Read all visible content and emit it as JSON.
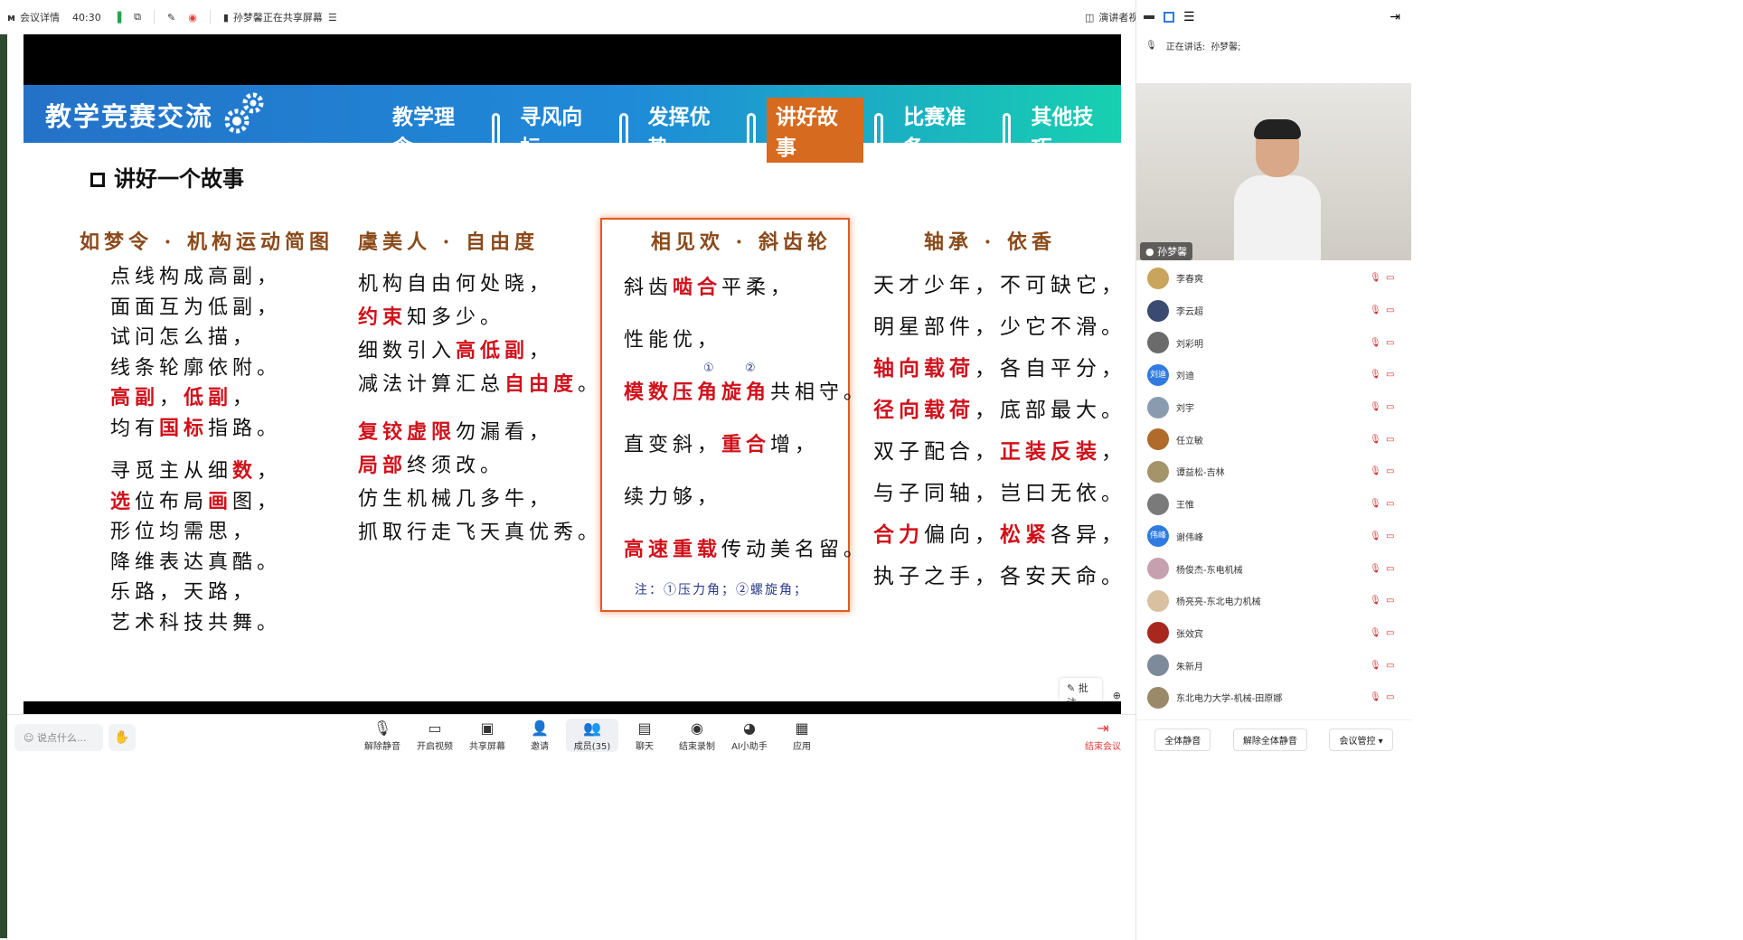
{
  "topbar": {
    "meeting_details": "会议详情",
    "duration": "40:30",
    "sharing_notice": "孙梦馨正在共享屏幕",
    "presenter_view": "演讲者视"
  },
  "slide": {
    "title": "教学竞赛交流",
    "nav": [
      "教学理念",
      "寻风向标",
      "发挥优势",
      "讲好故事",
      "比赛准备",
      "其他技巧"
    ],
    "active_nav": "讲好故事",
    "heading": "讲好一个故事",
    "poem1": {
      "title": "如梦令 · 机构运动简图",
      "lines": [
        [
          {
            "t": "点线构成高副，"
          }
        ],
        [
          {
            "t": "面面互为低副，"
          }
        ],
        [
          {
            "t": "试问怎么描，"
          }
        ],
        [
          {
            "t": "线条轮廓依附。"
          }
        ],
        [
          {
            "t": "高副",
            "r": true
          },
          {
            "t": "，"
          },
          {
            "t": "低副",
            "r": true
          },
          {
            "t": "，"
          }
        ],
        [
          {
            "t": "均有"
          },
          {
            "t": "国标",
            "r": true
          },
          {
            "t": "指路。"
          }
        ]
      ],
      "lines2": [
        [
          {
            "t": "寻"
          },
          {
            "t": "觅",
            "r": false
          },
          {
            "t": "主从细"
          },
          {
            "t": "数",
            "r": true
          },
          {
            "t": "，"
          }
        ],
        [
          {
            "t": "选",
            "r": true
          },
          {
            "t": "位布局"
          },
          {
            "t": "画",
            "r": true
          },
          {
            "t": "图，"
          }
        ],
        [
          {
            "t": "形位均需思，"
          }
        ],
        [
          {
            "t": "降维表达真酷。"
          }
        ],
        [
          {
            "t": "乐路，天路，"
          }
        ],
        [
          {
            "t": "艺术科技共舞。"
          }
        ]
      ]
    },
    "poem2": {
      "title": "虞美人 · 自由度",
      "lines": [
        [
          {
            "t": "机构自由何处晓，"
          }
        ],
        [
          {
            "t": "约束",
            "r": true
          },
          {
            "t": "知多少。"
          }
        ],
        [
          {
            "t": "细数引入"
          },
          {
            "t": "高低副",
            "r": true
          },
          {
            "t": "，"
          }
        ],
        [
          {
            "t": "减法计算汇总"
          },
          {
            "t": "自由度",
            "r": true
          },
          {
            "t": "。"
          }
        ]
      ],
      "lines2": [
        [
          {
            "t": "复铰虚限",
            "r": true
          },
          {
            "t": "勿漏看，"
          }
        ],
        [
          {
            "t": "局部",
            "r": true
          },
          {
            "t": "终须改。"
          }
        ],
        [
          {
            "t": "仿生机械几多牛，"
          }
        ],
        [
          {
            "t": "抓取行走飞天真优秀。"
          }
        ]
      ]
    },
    "poem3": {
      "title": "相见欢 · 斜齿轮",
      "lines": [
        [
          {
            "t": "斜齿"
          },
          {
            "t": "啮合",
            "r": true
          },
          {
            "t": "平柔，"
          }
        ],
        [
          {
            "t": "性能优，"
          }
        ],
        [
          {
            "t": "模数压角旋角",
            "r": true
          },
          {
            "t": "共相守。"
          }
        ],
        [
          {
            "t": "直变斜，"
          },
          {
            "t": "重合",
            "r": true
          },
          {
            "t": "增，"
          }
        ],
        [
          {
            "t": "续力够，"
          }
        ],
        [
          {
            "t": "高速重载",
            "r": true
          },
          {
            "t": "传动美名留。"
          }
        ]
      ],
      "note": "注：①压力角；②螺旋角；",
      "mark1": "①",
      "mark2": "②"
    },
    "poem4": {
      "title": "轴承 · 依香",
      "lines": [
        [
          {
            "t": "天才少年，不可缺它，"
          }
        ],
        [
          {
            "t": "明星部件，少它不滑。"
          }
        ],
        [
          {
            "t": "轴向载荷",
            "r": true
          },
          {
            "t": "，各自平分，"
          }
        ],
        [
          {
            "t": "径向载荷",
            "r": true
          },
          {
            "t": "，底部最大。"
          }
        ],
        [
          {
            "t": "双子配合，"
          },
          {
            "t": "正装反装",
            "r": true
          },
          {
            "t": "，"
          }
        ],
        [
          {
            "t": "与子同轴，岂曰无依。"
          }
        ],
        [
          {
            "t": "合力",
            "r": true
          },
          {
            "t": "偏向，"
          },
          {
            "t": "松紧",
            "r": true
          },
          {
            "t": "各异，"
          }
        ],
        [
          {
            "t": "执子之手，各安天命。"
          }
        ]
      ]
    },
    "annotate_label": "批注"
  },
  "toolbar": {
    "say_placeholder": "说点什么...",
    "items": [
      {
        "label": "解除静音",
        "icon": "mic-muted-icon"
      },
      {
        "label": "开启视频",
        "icon": "video-off-icon"
      },
      {
        "label": "共享屏幕",
        "icon": "share-screen-icon"
      },
      {
        "label": "邀请",
        "icon": "invite-icon"
      },
      {
        "label": "成员(35)",
        "icon": "members-icon"
      },
      {
        "label": "聊天",
        "icon": "chat-icon"
      },
      {
        "label": "结束录制",
        "icon": "record-icon"
      },
      {
        "label": "AI小助手",
        "icon": "ai-assistant-icon"
      },
      {
        "label": "应用",
        "icon": "apps-icon"
      }
    ],
    "end_meeting": "结束会议"
  },
  "panel": {
    "speaking_label": "正在讲话:",
    "speaking_name": "孙梦馨;",
    "video_name": "孙梦馨",
    "members": [
      {
        "name": "李春爽",
        "color": "#c9a45c"
      },
      {
        "name": "李云超",
        "color": "#3b4a70"
      },
      {
        "name": "刘彩明",
        "color": "#6b6b6b"
      },
      {
        "name": "刘迪",
        "color": "#2f7be0",
        "initial": "刘迪"
      },
      {
        "name": "刘宇",
        "color": "#8a9bb0"
      },
      {
        "name": "任立敏",
        "color": "#b06a2a"
      },
      {
        "name": "谭益松-吉林",
        "color": "#a5946a"
      },
      {
        "name": "王惟",
        "color": "#7a7a7a"
      },
      {
        "name": "谢伟峰",
        "color": "#2f7be0",
        "initial": "伟峰"
      },
      {
        "name": "杨俊杰-东电机械",
        "color": "#c7a0b0"
      },
      {
        "name": "杨亮亮-东北电力机械",
        "color": "#d9c0a0"
      },
      {
        "name": "张效宾",
        "color": "#a8281e"
      },
      {
        "name": "朱新月",
        "color": "#7d8a9a"
      },
      {
        "name": "东北电力大学-机械-田原娜",
        "color": "#9a8a6a"
      }
    ],
    "mute_all": "全体静音",
    "unmute_all": "解除全体静音",
    "manage": "会议管控"
  }
}
